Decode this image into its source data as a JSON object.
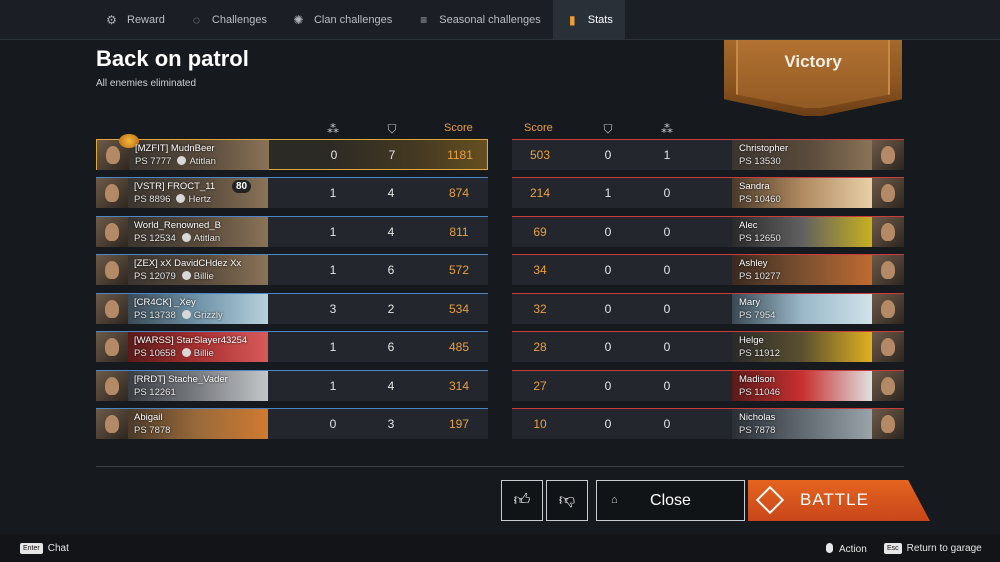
{
  "tabs": [
    {
      "label": "Reward",
      "icon": "reward-icon"
    },
    {
      "label": "Challenges",
      "icon": "challenges-icon"
    },
    {
      "label": "Clan challenges",
      "icon": "clan-challenges-icon"
    },
    {
      "label": "Seasonal challenges",
      "icon": "seasonal-icon"
    },
    {
      "label": "Stats",
      "icon": "stats-icon",
      "active": true
    }
  ],
  "headline": {
    "title": "Back on patrol",
    "subtitle": "All enemies eliminated"
  },
  "banner": {
    "result": "Victory"
  },
  "columns": {
    "score": "Score"
  },
  "team_allies": [
    {
      "name": "[MZFIT] MudnBeer",
      "ps": "PS 7777",
      "commander": "Atitlan",
      "kills": "0",
      "assists": "7",
      "score": "1181",
      "me": true
    },
    {
      "name": "[VSTR] FROCT_11",
      "ps": "PS 8896",
      "commander": "Hertz",
      "kills": "1",
      "assists": "4",
      "score": "874",
      "level": "80"
    },
    {
      "name": "World_Renowned_B",
      "ps": "PS 12534",
      "commander": "Atitlan",
      "kills": "1",
      "assists": "4",
      "score": "811"
    },
    {
      "name": "[ZEX] xX DavidCHdez Xx",
      "ps": "PS 12079",
      "commander": "Billie",
      "kills": "1",
      "assists": "6",
      "score": "572"
    },
    {
      "name": "[CR4CK] _Xey",
      "ps": "PS 13738",
      "commander": "Grizzly",
      "kills": "3",
      "assists": "2",
      "score": "534"
    },
    {
      "name": "[WARSS] StarSlayer43254",
      "ps": "PS 10658",
      "commander": "Billie",
      "kills": "1",
      "assists": "6",
      "score": "485"
    },
    {
      "name": "[RRDT] Stache_Vader",
      "ps": "PS 12261",
      "commander": "",
      "kills": "1",
      "assists": "4",
      "score": "314"
    },
    {
      "name": "Abigail",
      "ps": "PS 7878",
      "commander": "",
      "kills": "0",
      "assists": "3",
      "score": "197"
    }
  ],
  "team_enemies": [
    {
      "name": "Christopher",
      "ps": "PS 13530",
      "score": "503",
      "assists": "0",
      "kills": "1"
    },
    {
      "name": "Sandra",
      "ps": "PS 10460",
      "score": "214",
      "assists": "1",
      "kills": "0"
    },
    {
      "name": "Alec",
      "ps": "PS 12650",
      "score": "69",
      "assists": "0",
      "kills": "0"
    },
    {
      "name": "Ashley",
      "ps": "PS 10277",
      "score": "34",
      "assists": "0",
      "kills": "0"
    },
    {
      "name": "Mary",
      "ps": "PS 7954",
      "score": "32",
      "assists": "0",
      "kills": "0"
    },
    {
      "name": "Helge",
      "ps": "PS 11912",
      "score": "28",
      "assists": "0",
      "kills": "0"
    },
    {
      "name": "Madison",
      "ps": "PS 11046",
      "score": "27",
      "assists": "0",
      "kills": "0"
    },
    {
      "name": "Nicholas",
      "ps": "PS 7878",
      "score": "10",
      "assists": "0",
      "kills": "0"
    }
  ],
  "buttons": {
    "close": "Close",
    "battle": "BATTLE"
  },
  "footer": {
    "chat_key": "Enter",
    "chat": "Chat",
    "action": "Action",
    "garage_key": "Esc",
    "garage": "Return to garage"
  },
  "colors": {
    "accent": "#e8a040",
    "ally_line": "#4a86c8",
    "enemy_line": "#cc3b3b",
    "battle": "#e5641f"
  }
}
